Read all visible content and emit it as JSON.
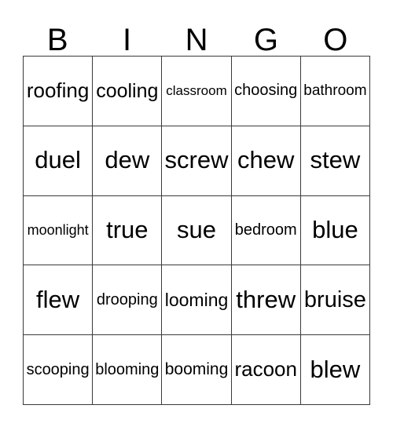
{
  "card": {
    "title_letters": [
      "B",
      "I",
      "N",
      "G",
      "O"
    ],
    "columns": 5,
    "rows": 5,
    "border_color": "#3a3a3a",
    "text_color": "#000000",
    "background_color": "#ffffff",
    "grid": [
      [
        "roofing",
        "cooling",
        "classroom",
        "choosing",
        "bathroom"
      ],
      [
        "duel",
        "dew",
        "screw",
        "chew",
        "stew"
      ],
      [
        "moonlight",
        "true",
        "sue",
        "bedroom",
        "blue"
      ],
      [
        "flew",
        "drooping",
        "looming",
        "threw",
        "bruise"
      ],
      [
        "scooping",
        "blooming",
        "booming",
        "racoon",
        "blew"
      ]
    ]
  }
}
